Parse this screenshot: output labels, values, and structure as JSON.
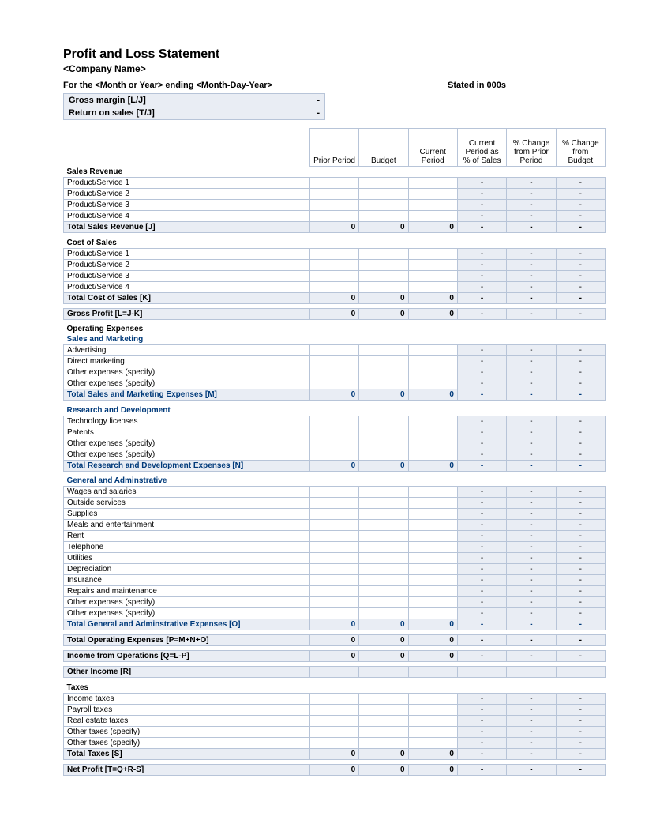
{
  "title": "Profit and Loss Statement",
  "company": "<Company Name>",
  "period": "For the <Month or Year> ending <Month-Day-Year>",
  "stated": "Stated in 000s",
  "metrics": {
    "gross_margin_label": "Gross margin  [L/J]",
    "gross_margin_val": "-",
    "return_on_sales_label": "Return on sales  [T/J]",
    "return_on_sales_val": "-"
  },
  "columns": {
    "c1": "Prior Period",
    "c2": "Budget",
    "c3": "Current Period",
    "c4": "Current Period as % of Sales",
    "c5": "% Change from Prior Period",
    "c6": "% Change from Budget"
  },
  "sections": {
    "sales_revenue": {
      "heading": "Sales Revenue",
      "rows": [
        {
          "label": "Product/Service 1",
          "c1": "",
          "c2": "",
          "c3": "",
          "c4": "-",
          "c5": "-",
          "c6": "-"
        },
        {
          "label": "Product/Service 2",
          "c1": "",
          "c2": "",
          "c3": "",
          "c4": "-",
          "c5": "-",
          "c6": "-"
        },
        {
          "label": "Product/Service 3",
          "c1": "",
          "c2": "",
          "c3": "",
          "c4": "-",
          "c5": "-",
          "c6": "-"
        },
        {
          "label": "Product/Service 4",
          "c1": "",
          "c2": "",
          "c3": "",
          "c4": "-",
          "c5": "-",
          "c6": "-"
        }
      ],
      "total": {
        "label": "Total Sales Revenue  [J]",
        "c1": "0",
        "c2": "0",
        "c3": "0",
        "c4": "-",
        "c5": "-",
        "c6": "-"
      }
    },
    "cost_of_sales": {
      "heading": "Cost of Sales",
      "rows": [
        {
          "label": "Product/Service 1",
          "c1": "",
          "c2": "",
          "c3": "",
          "c4": "-",
          "c5": "-",
          "c6": "-"
        },
        {
          "label": "Product/Service 2",
          "c1": "",
          "c2": "",
          "c3": "",
          "c4": "-",
          "c5": "-",
          "c6": "-"
        },
        {
          "label": "Product/Service 3",
          "c1": "",
          "c2": "",
          "c3": "",
          "c4": "-",
          "c5": "-",
          "c6": "-"
        },
        {
          "label": "Product/Service 4",
          "c1": "",
          "c2": "",
          "c3": "",
          "c4": "-",
          "c5": "-",
          "c6": "-"
        }
      ],
      "total": {
        "label": "Total Cost of Sales  [K]",
        "c1": "0",
        "c2": "0",
        "c3": "0",
        "c4": "-",
        "c5": "-",
        "c6": "-"
      }
    },
    "gross_profit": {
      "label": "Gross Profit  [L=J-K]",
      "c1": "0",
      "c2": "0",
      "c3": "0",
      "c4": "-",
      "c5": "-",
      "c6": "-"
    },
    "operating_expenses": {
      "heading": "Operating Expenses",
      "sales_marketing": {
        "heading": "Sales and Marketing",
        "rows": [
          {
            "label": "Advertising",
            "c1": "",
            "c2": "",
            "c3": "",
            "c4": "-",
            "c5": "-",
            "c6": "-"
          },
          {
            "label": "Direct marketing",
            "c1": "",
            "c2": "",
            "c3": "",
            "c4": "-",
            "c5": "-",
            "c6": "-"
          },
          {
            "label": "Other expenses (specify)",
            "c1": "",
            "c2": "",
            "c3": "",
            "c4": "-",
            "c5": "-",
            "c6": "-"
          },
          {
            "label": "Other expenses (specify)",
            "c1": "",
            "c2": "",
            "c3": "",
            "c4": "-",
            "c5": "-",
            "c6": "-"
          }
        ],
        "total": {
          "label": "Total Sales and Marketing Expenses  [M]",
          "c1": "0",
          "c2": "0",
          "c3": "0",
          "c4": "-",
          "c5": "-",
          "c6": "-"
        }
      },
      "research_development": {
        "heading": "Research and Development",
        "rows": [
          {
            "label": "Technology licenses",
            "c1": "",
            "c2": "",
            "c3": "",
            "c4": "-",
            "c5": "-",
            "c6": "-"
          },
          {
            "label": "Patents",
            "c1": "",
            "c2": "",
            "c3": "",
            "c4": "-",
            "c5": "-",
            "c6": "-"
          },
          {
            "label": "Other expenses (specify)",
            "c1": "",
            "c2": "",
            "c3": "",
            "c4": "-",
            "c5": "-",
            "c6": "-"
          },
          {
            "label": "Other expenses (specify)",
            "c1": "",
            "c2": "",
            "c3": "",
            "c4": "-",
            "c5": "-",
            "c6": "-"
          }
        ],
        "total": {
          "label": "Total Research and Development Expenses  [N]",
          "c1": "0",
          "c2": "0",
          "c3": "0",
          "c4": "-",
          "c5": "-",
          "c6": "-"
        }
      },
      "general_admin": {
        "heading": "General and Adminstrative",
        "rows": [
          {
            "label": "Wages and salaries",
            "c1": "",
            "c2": "",
            "c3": "",
            "c4": "-",
            "c5": "-",
            "c6": "-"
          },
          {
            "label": "Outside services",
            "c1": "",
            "c2": "",
            "c3": "",
            "c4": "-",
            "c5": "-",
            "c6": "-"
          },
          {
            "label": "Supplies",
            "c1": "",
            "c2": "",
            "c3": "",
            "c4": "-",
            "c5": "-",
            "c6": "-"
          },
          {
            "label": "Meals and entertainment",
            "c1": "",
            "c2": "",
            "c3": "",
            "c4": "-",
            "c5": "-",
            "c6": "-"
          },
          {
            "label": "Rent",
            "c1": "",
            "c2": "",
            "c3": "",
            "c4": "-",
            "c5": "-",
            "c6": "-"
          },
          {
            "label": "Telephone",
            "c1": "",
            "c2": "",
            "c3": "",
            "c4": "-",
            "c5": "-",
            "c6": "-"
          },
          {
            "label": "Utilities",
            "c1": "",
            "c2": "",
            "c3": "",
            "c4": "-",
            "c5": "-",
            "c6": "-"
          },
          {
            "label": "Depreciation",
            "c1": "",
            "c2": "",
            "c3": "",
            "c4": "-",
            "c5": "-",
            "c6": "-"
          },
          {
            "label": "Insurance",
            "c1": "",
            "c2": "",
            "c3": "",
            "c4": "-",
            "c5": "-",
            "c6": "-"
          },
          {
            "label": "Repairs and maintenance",
            "c1": "",
            "c2": "",
            "c3": "",
            "c4": "-",
            "c5": "-",
            "c6": "-"
          },
          {
            "label": "Other expenses (specify)",
            "c1": "",
            "c2": "",
            "c3": "",
            "c4": "-",
            "c5": "-",
            "c6": "-"
          },
          {
            "label": "Other expenses (specify)",
            "c1": "",
            "c2": "",
            "c3": "",
            "c4": "-",
            "c5": "-",
            "c6": "-"
          }
        ],
        "total": {
          "label": "Total General and Adminstrative Expenses  [O]",
          "c1": "0",
          "c2": "0",
          "c3": "0",
          "c4": "-",
          "c5": "-",
          "c6": "-"
        }
      },
      "total": {
        "label": "Total Operating Expenses  [P=M+N+O]",
        "c1": "0",
        "c2": "0",
        "c3": "0",
        "c4": "-",
        "c5": "-",
        "c6": "-"
      }
    },
    "income_from_operations": {
      "label": "Income from Operations  [Q=L-P]",
      "c1": "0",
      "c2": "0",
      "c3": "0",
      "c4": "-",
      "c5": "-",
      "c6": "-"
    },
    "other_income": {
      "label": "Other Income  [R]",
      "c1": "",
      "c2": "",
      "c3": "",
      "c4": "",
      "c5": "",
      "c6": ""
    },
    "taxes": {
      "heading": "Taxes",
      "rows": [
        {
          "label": "Income taxes",
          "c1": "",
          "c2": "",
          "c3": "",
          "c4": "-",
          "c5": "-",
          "c6": "-"
        },
        {
          "label": "Payroll taxes",
          "c1": "",
          "c2": "",
          "c3": "",
          "c4": "-",
          "c5": "-",
          "c6": "-"
        },
        {
          "label": "Real estate taxes",
          "c1": "",
          "c2": "",
          "c3": "",
          "c4": "-",
          "c5": "-",
          "c6": "-"
        },
        {
          "label": "Other taxes (specify)",
          "c1": "",
          "c2": "",
          "c3": "",
          "c4": "-",
          "c5": "-",
          "c6": "-"
        },
        {
          "label": "Other taxes (specify)",
          "c1": "",
          "c2": "",
          "c3": "",
          "c4": "-",
          "c5": "-",
          "c6": "-"
        }
      ],
      "total": {
        "label": "Total Taxes  [S]",
        "c1": "0",
        "c2": "0",
        "c3": "0",
        "c4": "-",
        "c5": "-",
        "c6": "-"
      }
    },
    "net_profit": {
      "label": "Net Profit  [T=Q+R-S]",
      "c1": "0",
      "c2": "0",
      "c3": "0",
      "c4": "-",
      "c5": "-",
      "c6": "-"
    }
  }
}
